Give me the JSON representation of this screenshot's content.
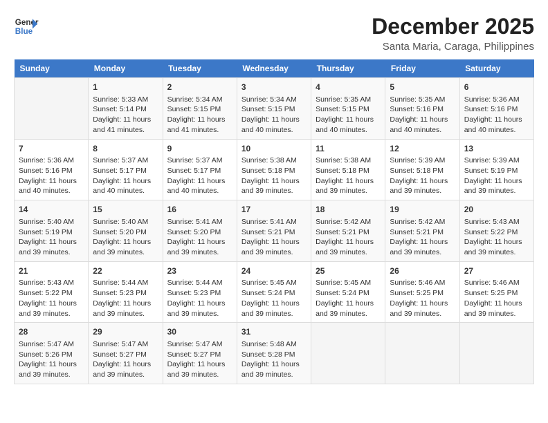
{
  "header": {
    "logo_line1": "General",
    "logo_line2": "Blue",
    "title": "December 2025",
    "subtitle": "Santa Maria, Caraga, Philippines"
  },
  "days_of_week": [
    "Sunday",
    "Monday",
    "Tuesday",
    "Wednesday",
    "Thursday",
    "Friday",
    "Saturday"
  ],
  "weeks": [
    [
      {
        "day": "",
        "content": ""
      },
      {
        "day": "1",
        "content": "Sunrise: 5:33 AM\nSunset: 5:14 PM\nDaylight: 11 hours and 41 minutes."
      },
      {
        "day": "2",
        "content": "Sunrise: 5:34 AM\nSunset: 5:15 PM\nDaylight: 11 hours and 41 minutes."
      },
      {
        "day": "3",
        "content": "Sunrise: 5:34 AM\nSunset: 5:15 PM\nDaylight: 11 hours and 40 minutes."
      },
      {
        "day": "4",
        "content": "Sunrise: 5:35 AM\nSunset: 5:15 PM\nDaylight: 11 hours and 40 minutes."
      },
      {
        "day": "5",
        "content": "Sunrise: 5:35 AM\nSunset: 5:16 PM\nDaylight: 11 hours and 40 minutes."
      },
      {
        "day": "6",
        "content": "Sunrise: 5:36 AM\nSunset: 5:16 PM\nDaylight: 11 hours and 40 minutes."
      }
    ],
    [
      {
        "day": "7",
        "content": "Sunrise: 5:36 AM\nSunset: 5:16 PM\nDaylight: 11 hours and 40 minutes."
      },
      {
        "day": "8",
        "content": "Sunrise: 5:37 AM\nSunset: 5:17 PM\nDaylight: 11 hours and 40 minutes."
      },
      {
        "day": "9",
        "content": "Sunrise: 5:37 AM\nSunset: 5:17 PM\nDaylight: 11 hours and 40 minutes."
      },
      {
        "day": "10",
        "content": "Sunrise: 5:38 AM\nSunset: 5:18 PM\nDaylight: 11 hours and 39 minutes."
      },
      {
        "day": "11",
        "content": "Sunrise: 5:38 AM\nSunset: 5:18 PM\nDaylight: 11 hours and 39 minutes."
      },
      {
        "day": "12",
        "content": "Sunrise: 5:39 AM\nSunset: 5:18 PM\nDaylight: 11 hours and 39 minutes."
      },
      {
        "day": "13",
        "content": "Sunrise: 5:39 AM\nSunset: 5:19 PM\nDaylight: 11 hours and 39 minutes."
      }
    ],
    [
      {
        "day": "14",
        "content": "Sunrise: 5:40 AM\nSunset: 5:19 PM\nDaylight: 11 hours and 39 minutes."
      },
      {
        "day": "15",
        "content": "Sunrise: 5:40 AM\nSunset: 5:20 PM\nDaylight: 11 hours and 39 minutes."
      },
      {
        "day": "16",
        "content": "Sunrise: 5:41 AM\nSunset: 5:20 PM\nDaylight: 11 hours and 39 minutes."
      },
      {
        "day": "17",
        "content": "Sunrise: 5:41 AM\nSunset: 5:21 PM\nDaylight: 11 hours and 39 minutes."
      },
      {
        "day": "18",
        "content": "Sunrise: 5:42 AM\nSunset: 5:21 PM\nDaylight: 11 hours and 39 minutes."
      },
      {
        "day": "19",
        "content": "Sunrise: 5:42 AM\nSunset: 5:21 PM\nDaylight: 11 hours and 39 minutes."
      },
      {
        "day": "20",
        "content": "Sunrise: 5:43 AM\nSunset: 5:22 PM\nDaylight: 11 hours and 39 minutes."
      }
    ],
    [
      {
        "day": "21",
        "content": "Sunrise: 5:43 AM\nSunset: 5:22 PM\nDaylight: 11 hours and 39 minutes."
      },
      {
        "day": "22",
        "content": "Sunrise: 5:44 AM\nSunset: 5:23 PM\nDaylight: 11 hours and 39 minutes."
      },
      {
        "day": "23",
        "content": "Sunrise: 5:44 AM\nSunset: 5:23 PM\nDaylight: 11 hours and 39 minutes."
      },
      {
        "day": "24",
        "content": "Sunrise: 5:45 AM\nSunset: 5:24 PM\nDaylight: 11 hours and 39 minutes."
      },
      {
        "day": "25",
        "content": "Sunrise: 5:45 AM\nSunset: 5:24 PM\nDaylight: 11 hours and 39 minutes."
      },
      {
        "day": "26",
        "content": "Sunrise: 5:46 AM\nSunset: 5:25 PM\nDaylight: 11 hours and 39 minutes."
      },
      {
        "day": "27",
        "content": "Sunrise: 5:46 AM\nSunset: 5:25 PM\nDaylight: 11 hours and 39 minutes."
      }
    ],
    [
      {
        "day": "28",
        "content": "Sunrise: 5:47 AM\nSunset: 5:26 PM\nDaylight: 11 hours and 39 minutes."
      },
      {
        "day": "29",
        "content": "Sunrise: 5:47 AM\nSunset: 5:27 PM\nDaylight: 11 hours and 39 minutes."
      },
      {
        "day": "30",
        "content": "Sunrise: 5:47 AM\nSunset: 5:27 PM\nDaylight: 11 hours and 39 minutes."
      },
      {
        "day": "31",
        "content": "Sunrise: 5:48 AM\nSunset: 5:28 PM\nDaylight: 11 hours and 39 minutes."
      },
      {
        "day": "",
        "content": ""
      },
      {
        "day": "",
        "content": ""
      },
      {
        "day": "",
        "content": ""
      }
    ]
  ]
}
